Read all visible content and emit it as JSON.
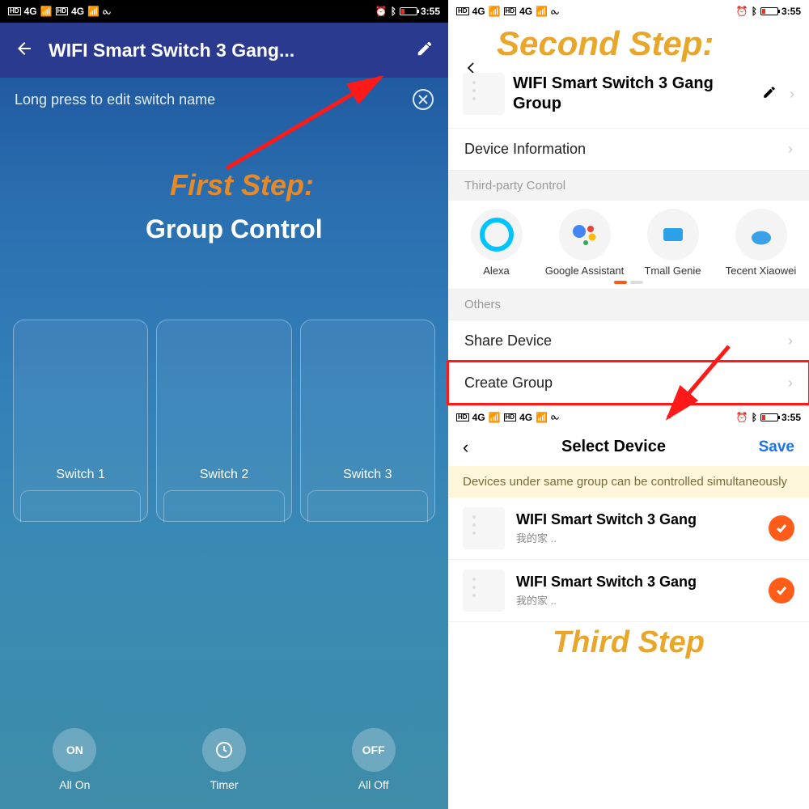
{
  "status": {
    "time": "3:55",
    "net1": "4G",
    "net2": "4G",
    "hd1": "HD",
    "hd2": "HD"
  },
  "left": {
    "title": "WIFI Smart Switch 3 Gang...",
    "hint": "Long press to edit switch name",
    "first_step_label": "First Step:",
    "group_control_label": "Group Control",
    "switches": [
      {
        "label": "Switch 1"
      },
      {
        "label": "Switch 2"
      },
      {
        "label": "Switch 3"
      }
    ],
    "controls": {
      "on_txt": "ON",
      "on_label": "All On",
      "timer_label": "Timer",
      "off_txt": "OFF",
      "off_label": "All Off"
    }
  },
  "right": {
    "second_step_label": "Second Step:",
    "device_name": "WIFI Smart Switch 3 Gang Group",
    "menu": {
      "device_info": "Device Information",
      "third_party_hdr": "Third-party Control",
      "others_hdr": "Others",
      "share": "Share Device",
      "create_group": "Create Group"
    },
    "integrations": [
      {
        "name": "Alexa"
      },
      {
        "name": "Google Assistant"
      },
      {
        "name": "Tmall Genie"
      },
      {
        "name": "Tecent Xiaowei"
      }
    ],
    "third": {
      "title": "Select Device",
      "save": "Save",
      "info": "Devices under same group can be controlled simultaneously",
      "devices": [
        {
          "name": "WIFI Smart Switch 3 Gang",
          "sub": "我的家 .."
        },
        {
          "name": "WIFI Smart Switch 3 Gang",
          "sub": "我的家 .."
        }
      ],
      "third_step_label": "Third Step"
    }
  }
}
